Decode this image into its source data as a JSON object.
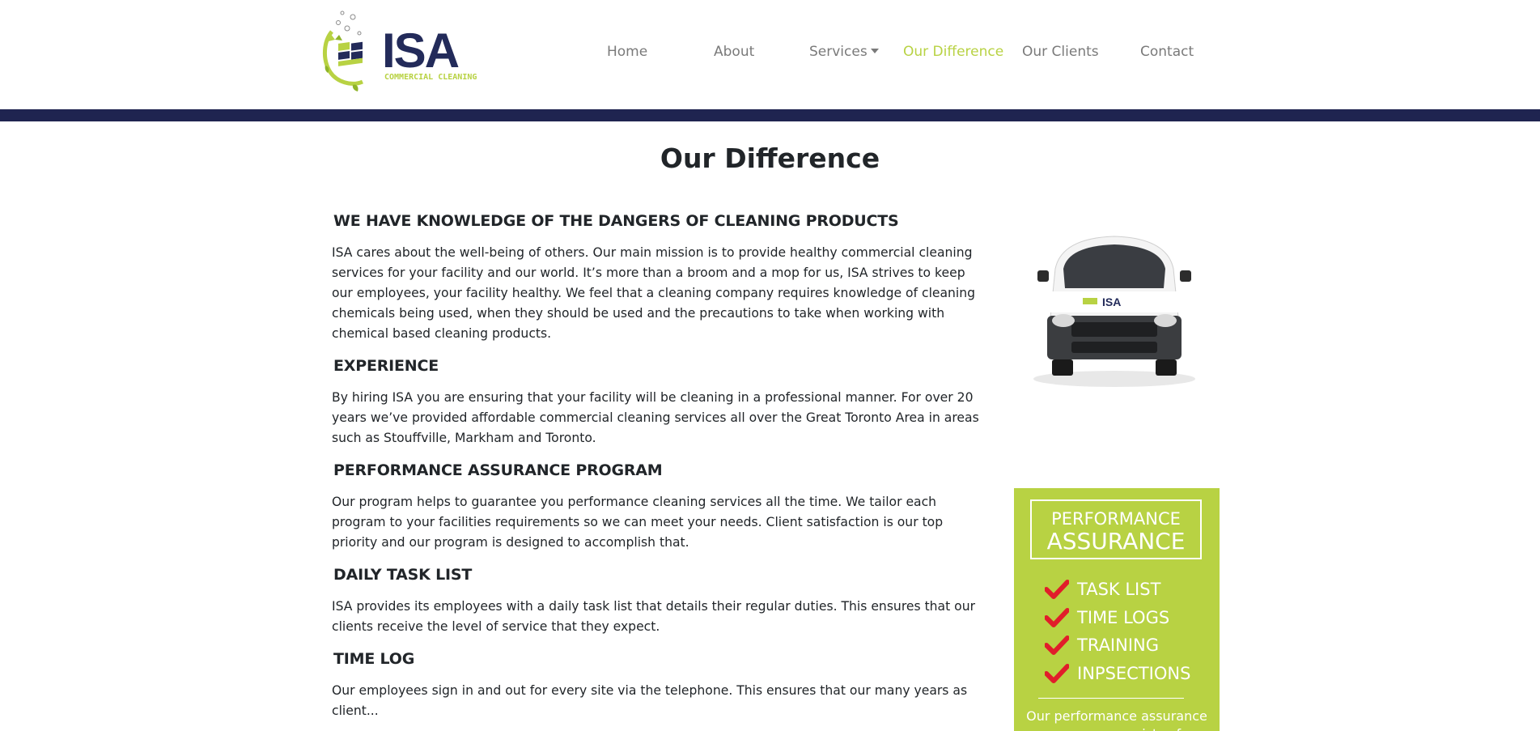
{
  "brand": {
    "name": "ISA",
    "tagline": "COMMERCIAL CLEANING",
    "colors": {
      "navy": "#1f2450",
      "lime": "#b8d243",
      "nav_text": "#7a7a7a",
      "check_red": "#e11d2a"
    }
  },
  "nav": {
    "home": "Home",
    "about": "About",
    "services": "Services",
    "difference": "Our Difference",
    "clients": "Our Clients",
    "contact": "Contact",
    "active": "Our Difference"
  },
  "page": {
    "title": "Our Difference"
  },
  "sections": [
    {
      "heading": "WE HAVE KNOWLEDGE OF THE DANGERS OF CLEANING PRODUCTS",
      "body": "ISA cares about the well-being of others. Our main mission is to provide healthy commercial cleaning services for your facility and our world. It’s more than a broom and a mop for us, ISA strives to keep our employees, your facility healthy. We feel that a cleaning company requires knowledge of cleaning chemicals being used, when they should be used and the precautions to take when working with chemical based cleaning products."
    },
    {
      "heading": "EXPERIENCE",
      "body": "By hiring ISA you are ensuring that your facility will be cleaning in a professional manner. For over 20 years we’ve provided affordable commercial cleaning services all over the Great Toronto Area in areas such as Stouffville, Markham and Toronto."
    },
    {
      "heading": "PERFORMANCE ASSURANCE PROGRAM",
      "body": "Our program helps to guarantee you performance cleaning services all the time. We tailor each program to your facilities requirements so we can meet your needs. Client satisfaction is our top priority and our program is designed to accomplish that."
    },
    {
      "heading": "DAILY TASK LIST",
      "body": "ISA provides its employees with a daily task list that details their regular duties. This ensures that our clients receive the level of service that they expect."
    },
    {
      "heading": "TIME LOG",
      "body": "Our employees sign in and out for every site via the telephone. This ensures that our many years as client..."
    }
  ],
  "sidebar": {
    "van_logo": "ISA",
    "promo": {
      "line1": "PERFORMANCE",
      "line2": "ASSURANCE",
      "checks": [
        "TASK LIST",
        "TIME LOGS",
        "TRAINING",
        "INPSECTIONS"
      ],
      "footer": "Our performance assurance program consists of"
    }
  }
}
